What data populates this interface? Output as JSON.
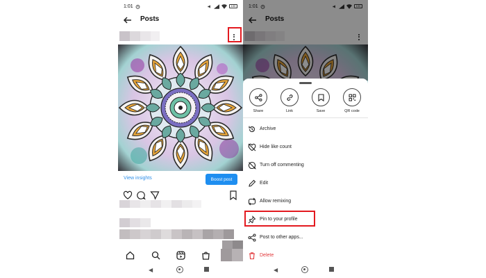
{
  "status_bar": {
    "time": "1:01",
    "battery": "100"
  },
  "header": {
    "title": "Posts"
  },
  "post": {
    "view_insights": "View insights",
    "boost_post": "Boost post"
  },
  "share_actions": [
    {
      "label": "Share",
      "icon": "share-icon"
    },
    {
      "label": "Link",
      "icon": "link-icon"
    },
    {
      "label": "Save",
      "icon": "bookmark-icon"
    },
    {
      "label": "QR code",
      "icon": "qr-code-icon"
    }
  ],
  "menu_items": [
    {
      "label": "Archive",
      "icon": "archive-icon"
    },
    {
      "label": "Hide like count",
      "icon": "hide-like-icon"
    },
    {
      "label": "Turn off commenting",
      "icon": "comment-off-icon"
    },
    {
      "label": "Edit",
      "icon": "edit-icon"
    },
    {
      "label": "Allow remixing",
      "icon": "remix-icon"
    },
    {
      "label": "Pin to your profile",
      "icon": "pin-icon"
    },
    {
      "label": "Post to other apps...",
      "icon": "share-apps-icon"
    },
    {
      "label": "Delete",
      "icon": "trash-icon"
    }
  ],
  "colors": {
    "accent_blue": "#1e8ef0",
    "link_blue": "#2f8fe8",
    "delete_red": "#e2383b",
    "highlight_red": "#e3191f"
  }
}
